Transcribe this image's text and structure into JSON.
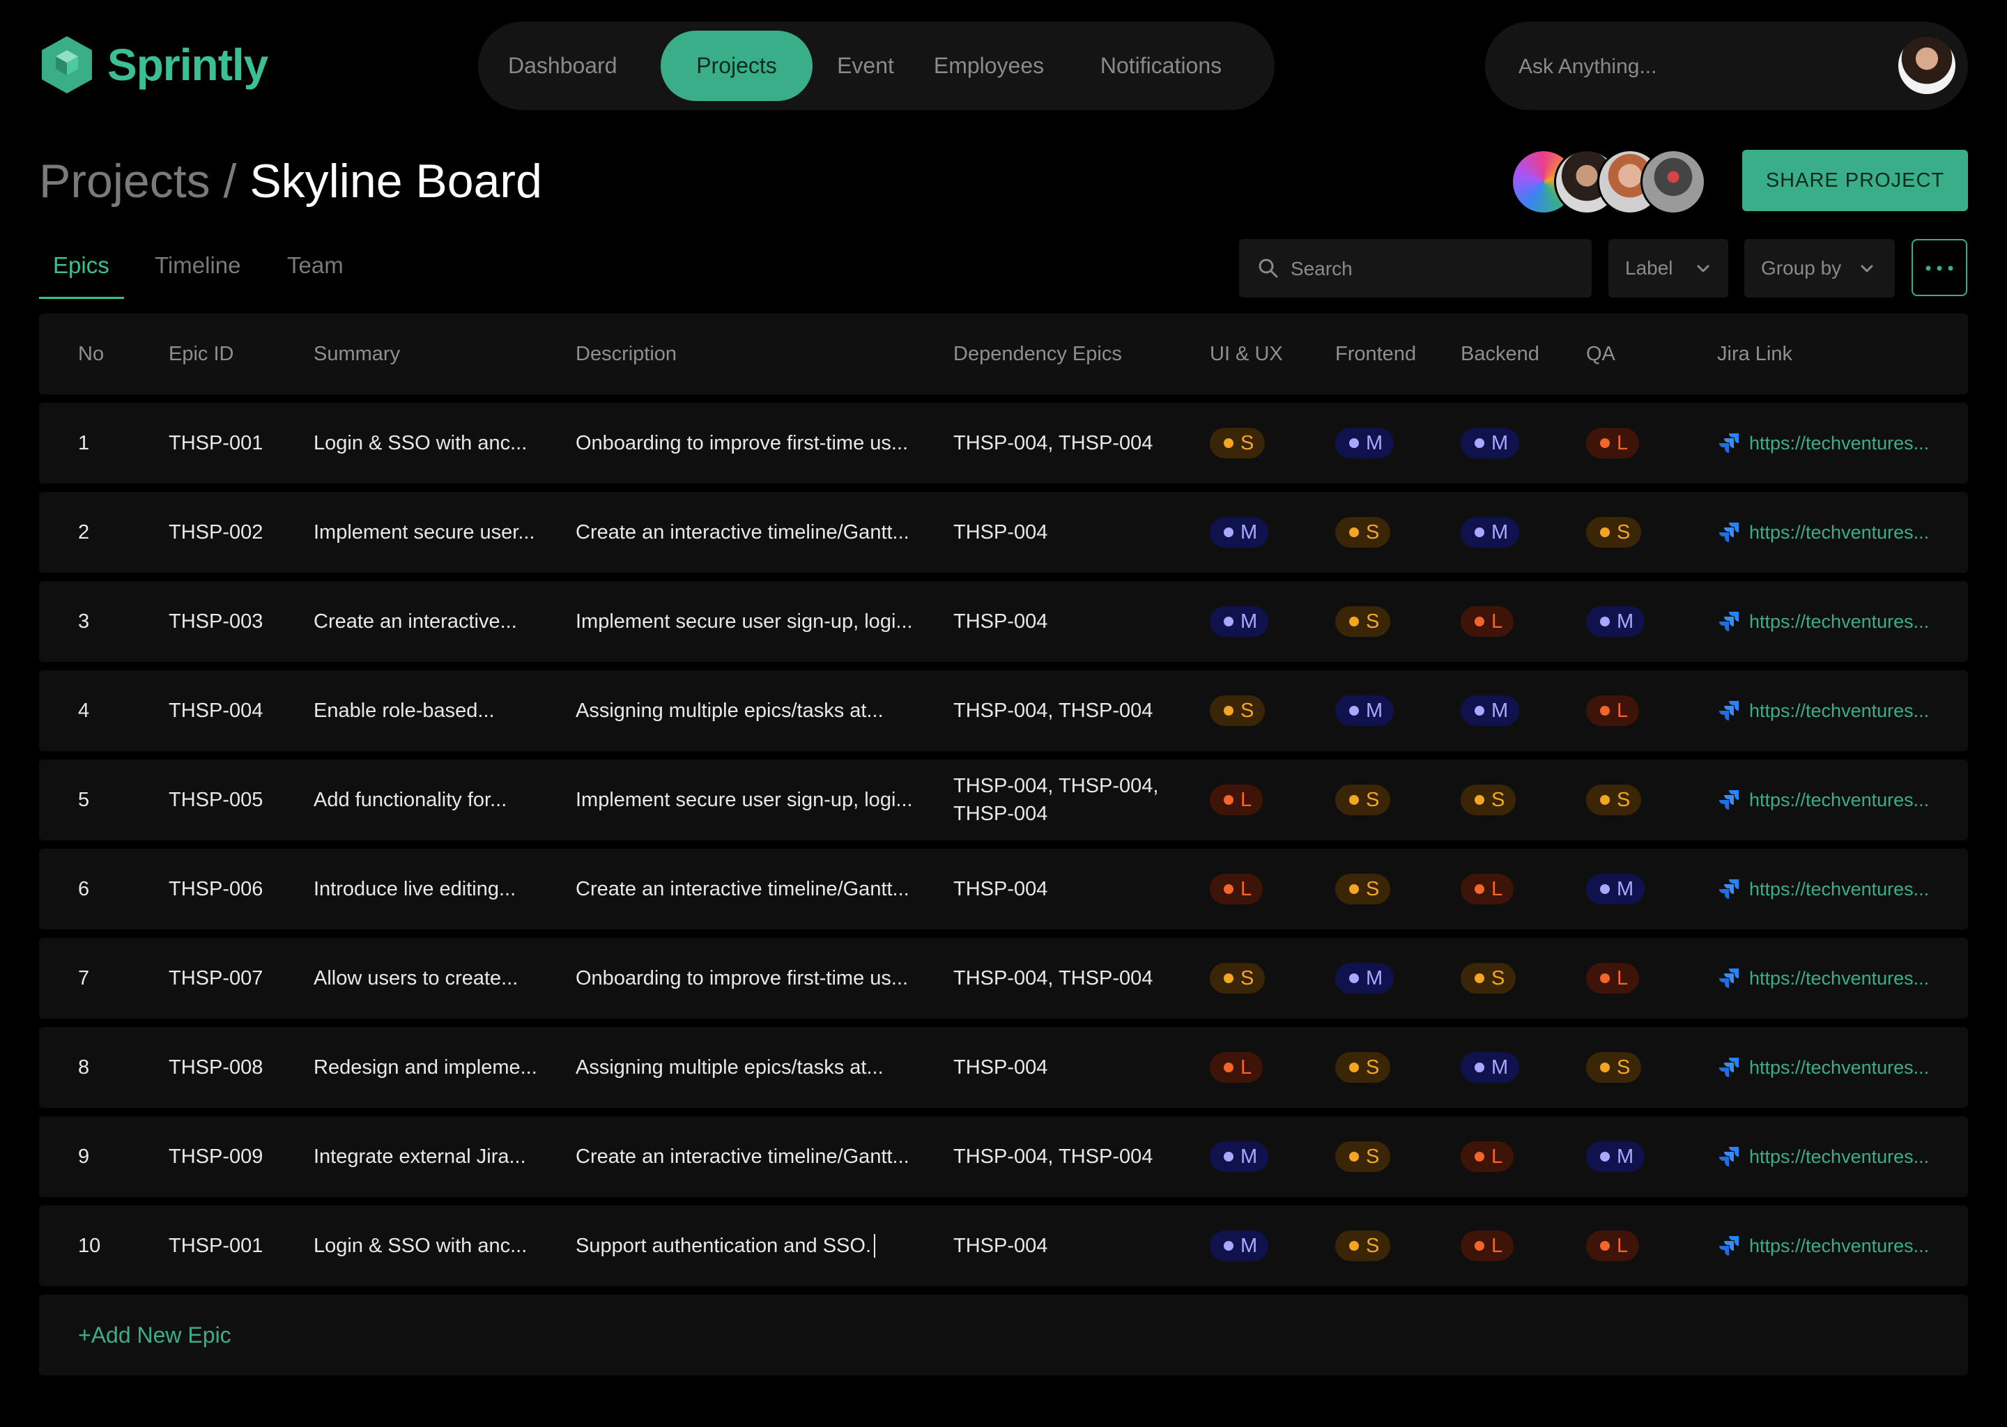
{
  "app": {
    "name": "Sprintly"
  },
  "nav": {
    "items": [
      {
        "label": "Dashboard",
        "active": false
      },
      {
        "label": "Projects",
        "active": true
      },
      {
        "label": "Event",
        "active": false
      },
      {
        "label": "Employees",
        "active": false
      },
      {
        "label": "Notifications",
        "active": false
      }
    ]
  },
  "ask": {
    "placeholder": "Ask Anything..."
  },
  "breadcrumb": {
    "parent": "Projects",
    "separator": " / ",
    "current": "Skyline Board"
  },
  "share_button": "SHARE PROJECT",
  "tabs": [
    {
      "label": "Epics",
      "active": true
    },
    {
      "label": "Timeline",
      "active": false
    },
    {
      "label": "Team",
      "active": false
    }
  ],
  "filters": {
    "search_placeholder": "Search",
    "label_dropdown": "Label",
    "group_by_dropdown": "Group by"
  },
  "table": {
    "columns": [
      "No",
      "Epic ID",
      "Summary",
      "Description",
      "Dependency Epics",
      "UI & UX",
      "Frontend",
      "Backend",
      "QA",
      "Jira Link"
    ],
    "rows": [
      {
        "no": "1",
        "epic_id": "THSP-001",
        "summary": "Login & SSO with anc...",
        "description": "Onboarding to improve first-time us...",
        "dependency": "THSP-004, THSP-004",
        "uiux": "S",
        "frontend": "M",
        "backend": "M",
        "qa": "L",
        "jira": "https://techventures..."
      },
      {
        "no": "2",
        "epic_id": "THSP-002",
        "summary": "Implement secure user...",
        "description": "Create an interactive timeline/Gantt...",
        "dependency": "THSP-004",
        "uiux": "M",
        "frontend": "S",
        "backend": "M",
        "qa": "S",
        "jira": "https://techventures..."
      },
      {
        "no": "3",
        "epic_id": "THSP-003",
        "summary": "Create an interactive...",
        "description": "Implement secure user sign-up, logi...",
        "dependency": "THSP-004",
        "uiux": "M",
        "frontend": "S",
        "backend": "L",
        "qa": "M",
        "jira": "https://techventures..."
      },
      {
        "no": "4",
        "epic_id": "THSP-004",
        "summary": "Enable role-based...",
        "description": "Assigning multiple epics/tasks at...",
        "dependency": "THSP-004, THSP-004",
        "uiux": "S",
        "frontend": "M",
        "backend": "M",
        "qa": "L",
        "jira": "https://techventures..."
      },
      {
        "no": "5",
        "epic_id": "THSP-005",
        "summary": "Add functionality for...",
        "description": "Implement secure user sign-up, logi...",
        "dependency": "THSP-004, THSP-004, THSP-004",
        "uiux": "L",
        "frontend": "S",
        "backend": "S",
        "qa": "S",
        "jira": "https://techventures..."
      },
      {
        "no": "6",
        "epic_id": "THSP-006",
        "summary": "Introduce live editing...",
        "description": "Create an interactive timeline/Gantt...",
        "dependency": "THSP-004",
        "uiux": "L",
        "frontend": "S",
        "backend": "L",
        "qa": "M",
        "jira": "https://techventures..."
      },
      {
        "no": "7",
        "epic_id": "THSP-007",
        "summary": "Allow users to create...",
        "description": "Onboarding to improve first-time us...",
        "dependency": "THSP-004, THSP-004",
        "uiux": "S",
        "frontend": "M",
        "backend": "S",
        "qa": "L",
        "jira": "https://techventures..."
      },
      {
        "no": "8",
        "epic_id": "THSP-008",
        "summary": "Redesign and impleme...",
        "description": "Assigning multiple epics/tasks at...",
        "dependency": "THSP-004",
        "uiux": "L",
        "frontend": "S",
        "backend": "M",
        "qa": "S",
        "jira": "https://techventures..."
      },
      {
        "no": "9",
        "epic_id": "THSP-009",
        "summary": "Integrate external Jira...",
        "description": "Create an interactive timeline/Gantt...",
        "dependency": "THSP-004, THSP-004",
        "uiux": "M",
        "frontend": "S",
        "backend": "L",
        "qa": "M",
        "jira": "https://techventures..."
      },
      {
        "no": "10",
        "epic_id": "THSP-001",
        "summary": "Login & SSO with anc...",
        "description": "Support authentication and SSO.",
        "dependency": "THSP-004",
        "uiux": "M",
        "frontend": "S",
        "backend": "L",
        "qa": "L",
        "jira": "https://techventures..."
      }
    ]
  },
  "add_epic": "+Add New Epic",
  "colors": {
    "accent": "#3aae88",
    "size_s": "#f5a524",
    "size_m": "#a7a9ff",
    "size_l": "#f4652b",
    "background": "#000000"
  }
}
